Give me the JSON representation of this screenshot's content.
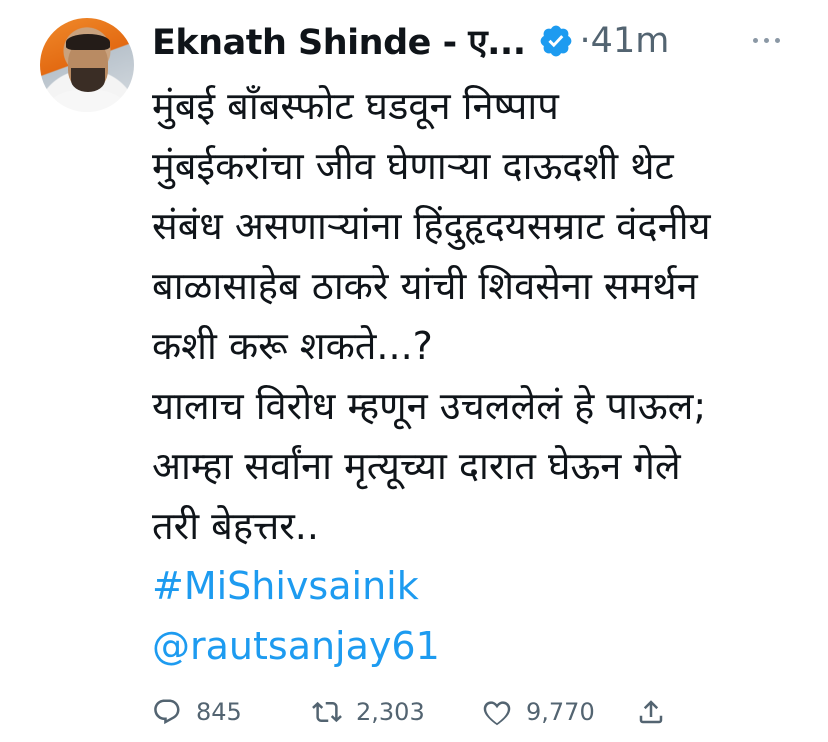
{
  "tweet": {
    "author_name": "Eknath Shinde - ए...",
    "separator": "·",
    "time": "41m",
    "text_lines": [
      "मुंबई बाँबस्फोट घडवून निष्पाप",
      "मुंबईकरांचा जीव घेणाऱ्या दाऊदशी थेट",
      "संबंध असणाऱ्यांना हिंदुहृदयसम्राट वंदनीय",
      "बाळासाहेब ठाकरे यांची शिवसेना समर्थन",
      "कशी करू शकते...?",
      "यालाच विरोध म्हणून उचललेलं हे पाऊल;",
      "आम्हा सर्वांना मृत्यूच्या दारात घेऊन गेले",
      "तरी बेहत्तर.."
    ],
    "hashtag": "#MiShivsainik",
    "mention": "@rautsanjay61",
    "stats": {
      "replies": "845",
      "retweets": "2,303",
      "likes": "9,770"
    },
    "icons": {
      "verified": "verified-badge-icon",
      "more": "more-icon",
      "reply": "reply-icon",
      "retweet": "retweet-icon",
      "like": "like-icon",
      "share": "share-icon"
    },
    "colors": {
      "link": "#1d9bf0",
      "verified": "#1d9bf0",
      "muted": "#536471",
      "text": "#0f1419"
    }
  }
}
